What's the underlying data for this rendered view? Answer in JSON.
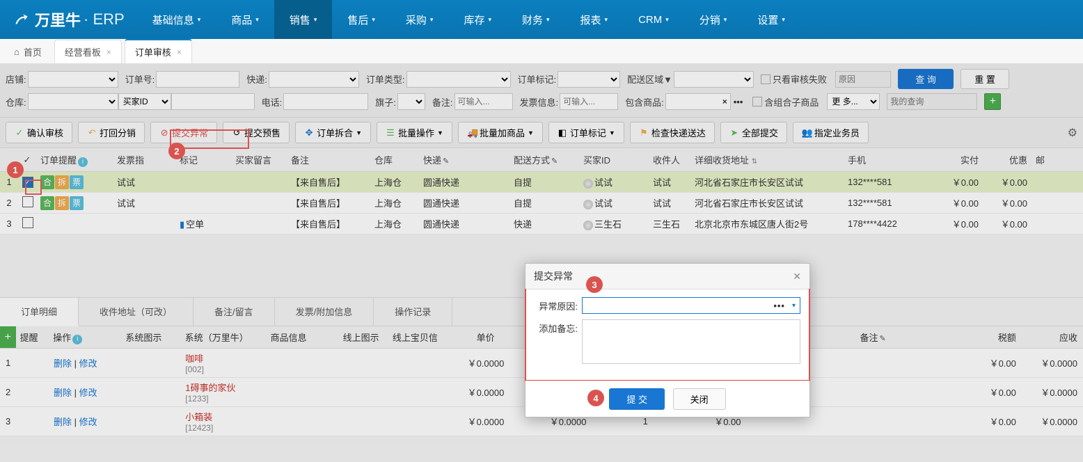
{
  "app": {
    "brand": "万里牛",
    "suffix": "· ERP"
  },
  "nav": {
    "items": [
      "基础信息",
      "商品",
      "销售",
      "售后",
      "采购",
      "库存",
      "财务",
      "报表",
      "CRM",
      "分销",
      "设置"
    ],
    "activeIndex": 2
  },
  "tabs": {
    "home": "首页",
    "t1": "经营看板",
    "t2": "订单审核"
  },
  "filters": {
    "row1": {
      "shop": "店铺:",
      "orderno": "订单号:",
      "express": "快递:",
      "ordertype": "订单类型:",
      "ordermark": "订单标记:",
      "delivarea": "配送区域▼",
      "auditfail": "只看审核失败",
      "reason_ph": "原因",
      "query": "查 询",
      "reset": "重 置"
    },
    "row2": {
      "wh": "仓库:",
      "buyerid": "买家ID",
      "phone": "电话:",
      "flag": "旗子:",
      "note": "备注:",
      "note_ph": "可输入...",
      "inv": "发票信息:",
      "inv_ph": "可输入...",
      "contain": "包含商品:",
      "combine": "含组合子商品",
      "more": "更 多...",
      "myquery_ph": "我的查询"
    }
  },
  "toolbar": {
    "confirm": "确认审核",
    "back": "打回分销",
    "abnormal": "提交异常",
    "presale": "提交预售",
    "split": "订单拆合",
    "batch": "批量操作",
    "addgoods": "批量加商品",
    "mark": "订单标记",
    "checkexp": "检查快递送达",
    "submitall": "全部提交",
    "assign": "指定业务员"
  },
  "cols": {
    "remind": "订单提醒",
    "inv": "发票指",
    "mark": "标记",
    "buyer": "买家留言",
    "note": "备注",
    "wh": "仓库",
    "express": "快递",
    "deliv": "配送方式",
    "buyid": "买家ID",
    "recv": "收件人",
    "addr": "详细收货地址",
    "phone": "手机",
    "pay": "实付",
    "disc": "优惠",
    "post": "邮"
  },
  "rows": [
    {
      "idx": "1",
      "checked": true,
      "badges": [
        "合",
        "拆",
        "票"
      ],
      "inv": "试试",
      "mark": "",
      "note": "【来自售后】",
      "wh": "上海仓",
      "express": "圆通快递",
      "deliv": "自提",
      "buyid": "试试",
      "recv": "试试",
      "addr": "河北省石家庄市长安区试试",
      "phone": "132****581",
      "pay": "￥0.00",
      "disc": "￥0.00"
    },
    {
      "idx": "2",
      "checked": false,
      "badges": [
        "合",
        "拆",
        "票"
      ],
      "inv": "试试",
      "mark": "",
      "note": "【来自售后】",
      "wh": "上海仓",
      "express": "圆通快递",
      "deliv": "自提",
      "buyid": "试试",
      "recv": "试试",
      "addr": "河北省石家庄市长安区试试",
      "phone": "132****581",
      "pay": "￥0.00",
      "disc": "￥0.00"
    },
    {
      "idx": "3",
      "checked": false,
      "badges": [],
      "inv": "",
      "mark": "空单",
      "note": "【来自售后】",
      "wh": "上海仓",
      "express": "圆通快递",
      "deliv": "快递",
      "buyid": "三生石",
      "recv": "三生石",
      "addr": "北京北京市东城区唐人街2号",
      "phone": "178****4422",
      "pay": "￥0.00",
      "disc": "￥0.00"
    }
  ],
  "btabs": {
    "detail": "订单明细",
    "addr": "收件地址（可改）",
    "note": "备注/留言",
    "inv": "发票/附加信息",
    "log": "操作记录"
  },
  "dcols": {
    "remind": "提醒",
    "op": "操作",
    "sysicon": "系统图示",
    "sys": "系统（万里牛）",
    "prod": "商品信息",
    "onlineicon": "线上图示",
    "online": "线上宝贝信",
    "price": "单价",
    "notes": "备注",
    "tax": "税额",
    "recv": "应收"
  },
  "drows": [
    {
      "idx": "1",
      "op_del": "删除",
      "op_mod": "修改",
      "name": "咖啡",
      "code": "[002]",
      "price": "￥0.0000",
      "p2": "",
      "qty": "",
      "amt": "",
      "tax": "￥0.00",
      "recv": "￥0.0000"
    },
    {
      "idx": "2",
      "op_del": "删除",
      "op_mod": "修改",
      "name": "1碍事的家伙",
      "code": "[1233]",
      "price": "￥0.0000",
      "p2": "",
      "qty": "",
      "amt": "",
      "tax": "￥0.00",
      "recv": "￥0.0000"
    },
    {
      "idx": "3",
      "op_del": "删除",
      "op_mod": "修改",
      "name": "小箱装",
      "code": "[12423]",
      "price": "￥0.0000",
      "p2": "￥0.0000",
      "qty": "1",
      "amt": "￥0.00",
      "tax": "￥0.00",
      "recv": "￥0.0000"
    }
  ],
  "modal": {
    "title": "提交异常",
    "reason": "异常原因:",
    "memo": "添加备忘:",
    "submit": "提 交",
    "close": "关闭"
  }
}
